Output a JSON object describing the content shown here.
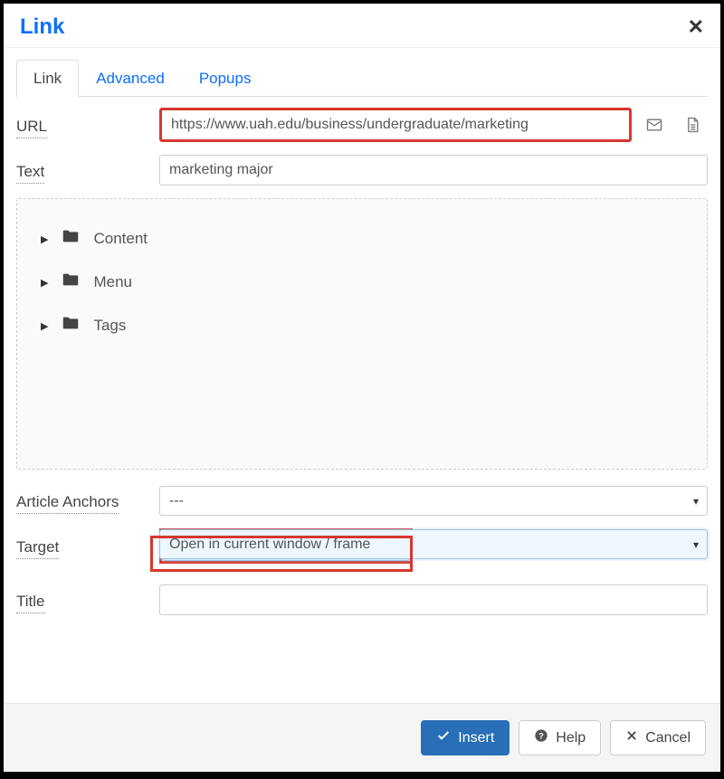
{
  "dialog": {
    "title": "Link"
  },
  "tabs": {
    "link": "Link",
    "advanced": "Advanced",
    "popups": "Popups"
  },
  "form": {
    "url_label": "URL",
    "url_value": "https://www.uah.edu/business/undergraduate/marketing",
    "text_label": "Text",
    "text_value": "marketing major",
    "anchors_label": "Article Anchors",
    "anchors_value": "---",
    "target_label": "Target",
    "target_value": "Open in current window / frame",
    "title_label": "Title",
    "title_value": ""
  },
  "tree": {
    "items": [
      "Content",
      "Menu",
      "Tags"
    ]
  },
  "footer": {
    "insert": "Insert",
    "help": "Help",
    "cancel": "Cancel"
  }
}
